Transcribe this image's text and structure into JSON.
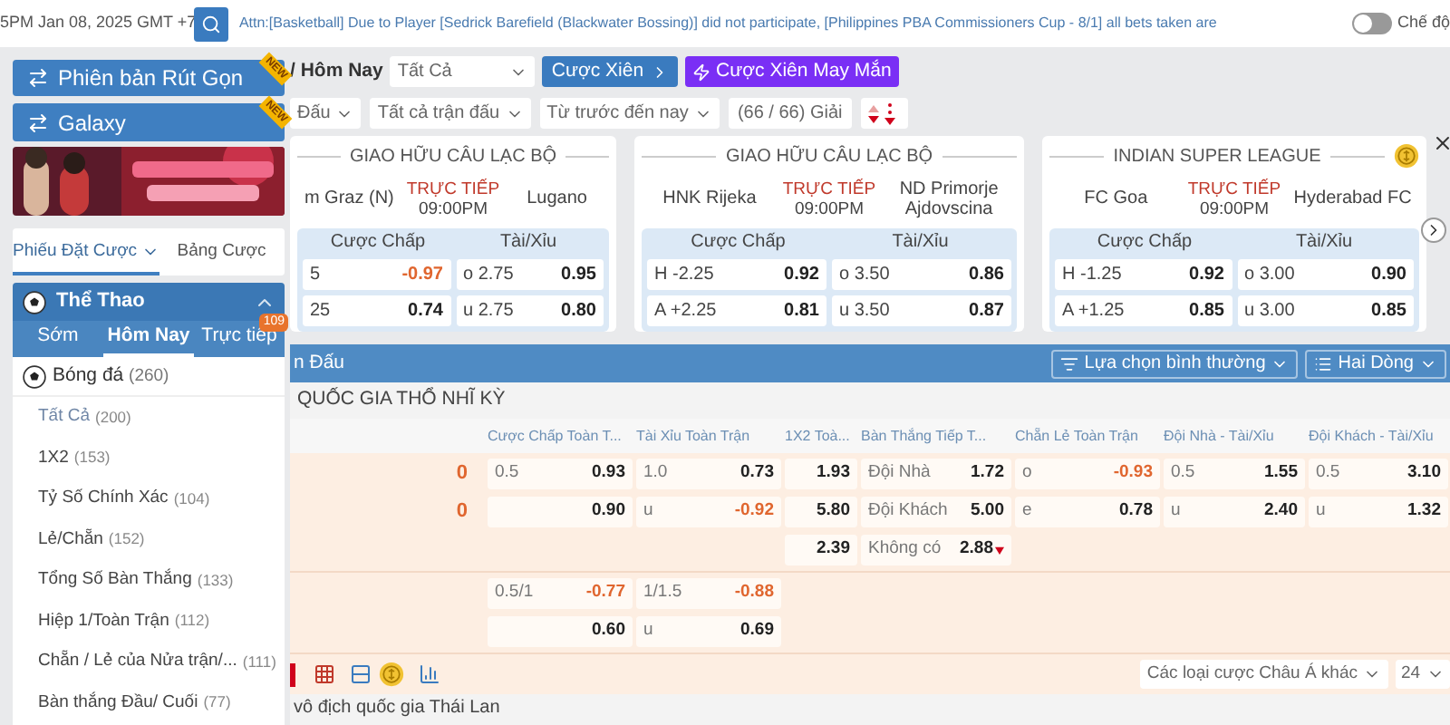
{
  "top_bar": {
    "datetime": "5PM Jan 08, 2025 GMT +7",
    "announcement": "Attn:[Basketball] Due to Player [Sedrick Barefield (Blackwater Bossing)] did not participate, [Philippines PBA Commissioners Cup - 8/1] all bets taken are",
    "mode_toggle": {
      "label": "Chế độ",
      "on": false
    }
  },
  "sidebar": {
    "version_buttons": [
      {
        "label": "Phiên bản Rút Gọn",
        "badge": "NEW"
      },
      {
        "label": "Galaxy",
        "badge": "NEW"
      }
    ],
    "bet_tabs": [
      {
        "label": "Phiếu Đặt Cược",
        "selected": true,
        "dropdown": true
      },
      {
        "label": "Bảng Cược",
        "selected": false,
        "dropdown": false
      }
    ],
    "sports_header": {
      "title": "Thể Thao",
      "expanded": true
    },
    "period_tabs": [
      {
        "label": "Sớm",
        "selected": false
      },
      {
        "label": "Hôm Nay",
        "selected": true
      },
      {
        "label": "Trực tiếp",
        "selected": false,
        "badge": "109"
      }
    ],
    "sport": {
      "name": "Bóng đá",
      "count": "(260)"
    },
    "markets": [
      {
        "name": "Tất Cả",
        "count": "(200)",
        "selected": true
      },
      {
        "name": "1X2",
        "count": "(153)",
        "selected": false
      },
      {
        "name": "Tỷ Số Chính Xác",
        "count": "(104)",
        "selected": false
      },
      {
        "name": "Lẻ/Chẵn",
        "count": "(152)",
        "selected": false
      },
      {
        "name": "Tổng Số Bàn Thắng",
        "count": "(133)",
        "selected": false
      },
      {
        "name": "Hiệp 1/Toàn Trận",
        "count": "(112)",
        "selected": false
      },
      {
        "name": "Chẵn / Lẻ của Nửa trận/...",
        "count": "(111)",
        "selected": false
      },
      {
        "name": "Bàn thắng Đầu/ Cuối",
        "count": "(77)",
        "selected": false
      }
    ]
  },
  "main": {
    "breadcrumb": "/ Hôm Nay",
    "filter_select": "Tất Cả",
    "parlay_button": "Cược Xiên",
    "lucky_parlay_button": "Cược Xiên May Mắn",
    "filters": [
      "Đấu",
      "Tất cả trận đấu",
      "Từ trước đến nay"
    ],
    "league_count": "(66 / 66) Giải",
    "featured": [
      {
        "league": "GIAO HỮU CÂU LẠC BỘ",
        "home": "m Graz (N)",
        "status": "TRỰC TIẾP",
        "time": "09:00PM",
        "away": "Lugano",
        "coin": false,
        "headers": [
          "Cược Chấp",
          "Tài/Xỉu"
        ],
        "rows": [
          [
            {
              "label": "5",
              "value": "-0.97",
              "highlighted": true
            },
            {
              "label": "o 2.75",
              "value": "0.95",
              "highlighted": false
            }
          ],
          [
            {
              "label": "25",
              "value": "0.74",
              "highlighted": false
            },
            {
              "label": "u 2.75",
              "value": "0.80",
              "highlighted": false
            }
          ]
        ]
      },
      {
        "league": "GIAO HỮU CÂU LẠC BỘ",
        "home": "HNK Rijeka",
        "status": "TRỰC TIẾP",
        "time": "09:00PM",
        "away": "ND Primorje Ajdovscina",
        "coin": false,
        "headers": [
          "Cược Chấp",
          "Tài/Xỉu"
        ],
        "rows": [
          [
            {
              "label": "H -2.25",
              "value": "0.92",
              "highlighted": false
            },
            {
              "label": "o 3.50",
              "value": "0.86",
              "highlighted": false
            }
          ],
          [
            {
              "label": "A +2.25",
              "value": "0.81",
              "highlighted": false
            },
            {
              "label": "u 3.50",
              "value": "0.87",
              "highlighted": false
            }
          ]
        ]
      },
      {
        "league": "INDIAN SUPER LEAGUE",
        "home": "FC Goa",
        "status": "TRỰC TIẾP",
        "time": "09:00PM",
        "away": "Hyderabad FC",
        "coin": true,
        "headers": [
          "Cược Chấp",
          "Tài/Xỉu"
        ],
        "rows": [
          [
            {
              "label": "H -1.25",
              "value": "0.92",
              "highlighted": false
            },
            {
              "label": "o 3.00",
              "value": "0.90",
              "highlighted": false
            }
          ],
          [
            {
              "label": "A +1.25",
              "value": "0.85",
              "highlighted": false
            },
            {
              "label": "u 3.00",
              "value": "0.85",
              "highlighted": false
            }
          ]
        ]
      }
    ],
    "section_bar": {
      "title": "n Đấu",
      "options": [
        "Lựa chọn bình thường",
        "Hai Dòng"
      ]
    },
    "league": {
      "name": "QUỐC GIA THỔ NHĨ KỲ",
      "columns": [
        "Cược Chấp Toàn T...",
        "Tài Xỉu Toàn Trận",
        "1X2 Toà...",
        "Bàn Thắng Tiếp T...",
        "Chẵn Lẻ Toàn Trận",
        "Đội Nhà - Tài/Xỉu",
        "Đội Khách - Tài/Xỉu"
      ],
      "groups": [
        {
          "rows": [
            {
              "score": "0",
              "cells": [
                {
                  "label": "0.5",
                  "value": "0.93",
                  "highlighted": false
                },
                {
                  "label": "1.0",
                  "value": "0.73",
                  "highlighted": false
                },
                {
                  "value": "1.93",
                  "highlighted": false
                },
                {
                  "label": "Đội Nhà",
                  "value": "1.72",
                  "highlighted": false
                },
                {
                  "label": "o",
                  "value": "-0.93",
                  "highlighted": true
                },
                {
                  "label": "0.5",
                  "value": "1.55",
                  "highlighted": false
                },
                {
                  "label": "0.5",
                  "value": "3.10",
                  "highlighted": false
                }
              ]
            },
            {
              "score": "0",
              "cells": [
                {
                  "value": "0.90",
                  "highlighted": false
                },
                {
                  "label": "u",
                  "value": "-0.92",
                  "highlighted": true
                },
                {
                  "value": "5.80",
                  "highlighted": false
                },
                {
                  "label": "Đội Khách",
                  "value": "5.00",
                  "highlighted": false
                },
                {
                  "label": "e",
                  "value": "0.78",
                  "highlighted": false
                },
                {
                  "label": "u",
                  "value": "2.40",
                  "highlighted": false
                },
                {
                  "label": "u",
                  "value": "1.32",
                  "highlighted": false
                }
              ]
            },
            {
              "cells": [
                null,
                null,
                {
                  "value": "2.39",
                  "highlighted": false
                },
                {
                  "label": "Không có",
                  "value": "2.88",
                  "highlighted": false,
                  "falling": true
                },
                null,
                null,
                null
              ]
            }
          ]
        },
        {
          "rows": [
            {
              "cells": [
                {
                  "label": "0.5/1",
                  "value": "-0.77",
                  "highlighted": true
                },
                {
                  "label": "1/1.5",
                  "value": "-0.88",
                  "highlighted": true
                },
                null,
                null,
                null,
                null,
                null
              ]
            },
            {
              "cells": [
                {
                  "value": "0.60",
                  "highlighted": false
                },
                {
                  "label": "u",
                  "value": "0.69",
                  "highlighted": false
                },
                null,
                null,
                null,
                null,
                null
              ]
            }
          ]
        }
      ],
      "more_select": "Các loại cược Châu Á khác",
      "page_size": "24"
    },
    "next_league": "vô địch quốc gia Thái Lan"
  }
}
